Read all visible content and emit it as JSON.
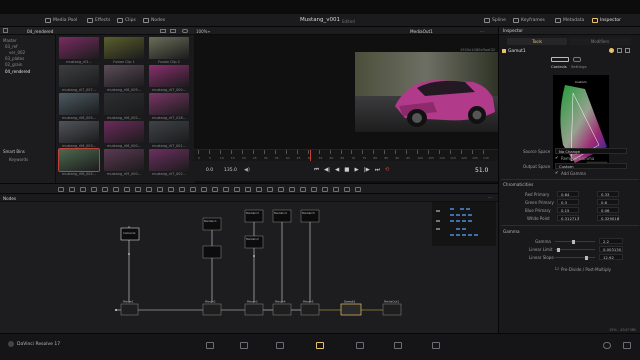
{
  "toolbar": {
    "media_pool": "Media Pool",
    "effects": "Effects",
    "clips": "Clips",
    "nodes": "Nodes",
    "spline": "Spline",
    "keyframes": "Keyframes",
    "metadata": "Metadata",
    "inspector": "Inspector"
  },
  "project": {
    "title": "Mustang_v001",
    "status": "Edited"
  },
  "mediapool": {
    "bin_name": "04_rendered",
    "tree": [
      "Master",
      "03_ref",
      "ver_002",
      "03_plates",
      "02_grain",
      "04_rendered"
    ],
    "smart_bins_label": "Smart Bins",
    "keywords_label": "Keywords",
    "clips": [
      "mustang_r01...",
      "Fusion Clip 1",
      "Fusion Clip 2",
      "mustang_r07_007...",
      "mustang_r08_009...",
      "mustang_r07_000...",
      "mustang_r06_005...",
      "mustang_r06_002...",
      "mustang_r07_018...",
      "mustang_r06_003...",
      "mustang_r06_000...",
      "mustang_r07_001...",
      "mustang_r06_004...",
      "mustang_r05_000...",
      "mustang_r07_002..."
    ]
  },
  "viewer": {
    "zoom": "100%",
    "output": "MediaOut1",
    "resolution": "1920x1080xfloat32",
    "time_start": "0.0",
    "time_end": "135.0",
    "current_frame": "51.0",
    "ruler": [
      "0",
      "5",
      "10",
      "15",
      "20",
      "25",
      "30",
      "35",
      "40",
      "45",
      "50",
      "55",
      "60",
      "65",
      "70",
      "75",
      "80",
      "85",
      "90",
      "95",
      "100",
      "105",
      "110",
      "115",
      "120",
      "125",
      "130"
    ]
  },
  "nodes": {
    "panel_title": "Nodes",
    "items": [
      "Camera1",
      "Gamut1",
      "MediaIn2",
      "Merge1",
      "Merge2",
      "Merge3",
      "Merge4",
      "Merge5",
      "Gamut1",
      "MediaOut1",
      "MediaIn1",
      "MediaIn3",
      "MediaIn4",
      "MediaIn5"
    ]
  },
  "inspector": {
    "title": "Inspector",
    "tabs": [
      "Tools",
      "Modifiers"
    ],
    "node_name": "Gamut1",
    "subtabs": [
      "Controls",
      "Settings"
    ],
    "gamut_tag": "1931 xy",
    "gamut_label": "Custom",
    "source_space_label": "Source Space",
    "source_space_value": "No Change",
    "remove_gamma": "Remove Gamma",
    "output_space_label": "Output Space",
    "output_space_value": "Custom",
    "add_gamma": "Add Gamma",
    "chromaticities": "Chromaticities",
    "red_primary_label": "Red Primary",
    "red_x": "0.64",
    "red_y": "0.33",
    "green_primary_label": "Green Primary",
    "green_x": "0.3",
    "green_y": "0.6",
    "blue_primary_label": "Blue Primary",
    "blue_x": "0.15",
    "blue_y": "0.06",
    "white_point_label": "White Point",
    "white_x": "0.312713",
    "white_y": "0.329016",
    "gamma_section": "Gamma",
    "gamma_label": "Gamma",
    "gamma_value": "2.2",
    "linear_limit_label": "Linear Limit",
    "linear_limit_value": "0.003130",
    "linear_slope_label": "Linear Slope",
    "linear_slope_value": "12.92",
    "predivide": "Pre-Divide / Post-Multiply"
  },
  "footer": {
    "app_name": "DaVinci Resolve 17",
    "stats": "15% - 4547 MB"
  },
  "colors": {
    "accent": "#e7c26a",
    "selection": "#c0423a",
    "car": "#b23a8a",
    "panel": "#1b1b1d"
  }
}
